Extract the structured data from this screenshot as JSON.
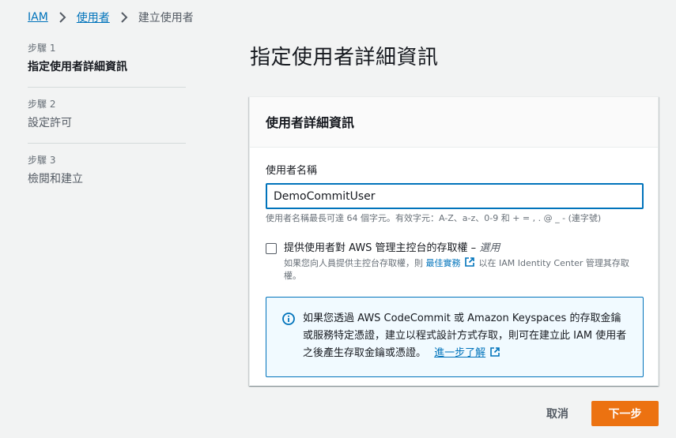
{
  "breadcrumb": {
    "items": [
      "IAM",
      "使用者"
    ],
    "current": "建立使用者"
  },
  "steps": [
    {
      "number": "步驟 1",
      "title": "指定使用者詳細資訊",
      "active": true
    },
    {
      "number": "步驟 2",
      "title": "設定許可",
      "active": false
    },
    {
      "number": "步驟 3",
      "title": "檢閱和建立",
      "active": false
    }
  ],
  "page": {
    "title": "指定使用者詳細資訊"
  },
  "card": {
    "title": "使用者詳細資訊",
    "username": {
      "label": "使用者名稱",
      "value": "DemoCommitUser",
      "hint": "使用者名稱最長可達 64 個字元。有效字元：A-Z、a-z、0-9 和 + = , . @ _ - (連字號)"
    },
    "console_access": {
      "label": "提供使用者對 AWS 管理主控台的存取權 –",
      "optional": "選用",
      "desc_before": "如果您向人員提供主控台存取權，則",
      "desc_link": "最佳實務",
      "desc_after": "以在 IAM Identity Center 管理其存取權。",
      "checked": false
    },
    "info": {
      "text": "如果您透過 AWS CodeCommit 或 Amazon Keyspaces 的存取金鑰或服務特定憑證，建立以程式設計方式存取，則可在建立此 IAM 使用者之後產生存取金鑰或憑證。",
      "link": "進一步了解"
    }
  },
  "footer": {
    "cancel_label": "取消",
    "next_label": "下一步"
  },
  "colors": {
    "accent": "#0073bb",
    "primary_button": "#ec7211",
    "info_bg": "#f1faff"
  }
}
